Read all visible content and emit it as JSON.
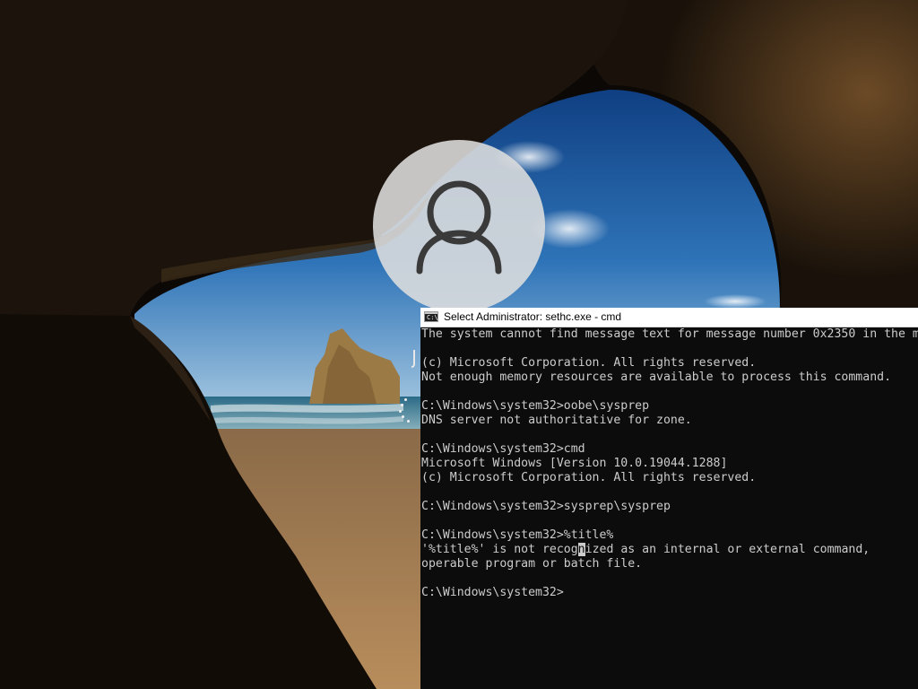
{
  "console": {
    "title": "Select Administrator: sethc.exe - cmd",
    "icon_glyph": "C:\\",
    "lines": [
      "The system cannot find message text for message number 0x2350 in the message file for Application.",
      "",
      "(c) Microsoft Corporation. All rights reserved.",
      "Not enough memory resources are available to process this command.",
      "",
      "C:\\Windows\\system32>oobe\\sysprep",
      "DNS server not authoritative for zone.",
      "",
      "C:\\Windows\\system32>cmd",
      "Microsoft Windows [Version 10.0.19044.1288]",
      "(c) Microsoft Corporation. All rights reserved.",
      "",
      "C:\\Windows\\system32>sysprep\\sysprep",
      "",
      "C:\\Windows\\system32>%title%"
    ],
    "error_line_before_cursor": "'%title%' is not recog",
    "cursor_char": "n",
    "error_line_after_cursor": "ized as an internal or external command,",
    "lines_after": [
      "operable program or batch file.",
      "",
      "C:\\Windows\\system32>"
    ]
  },
  "lockscreen": {
    "avatar_icon": "user-icon",
    "spinner_icon": "loading-spinner-icon"
  }
}
